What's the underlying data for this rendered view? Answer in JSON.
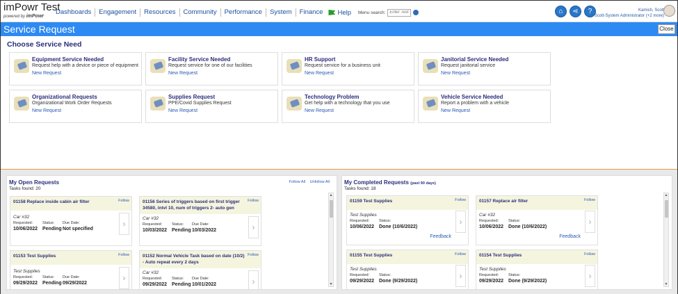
{
  "app": {
    "title": "imPowr Test",
    "powered_by": "powered by",
    "brand": "imPowr"
  },
  "nav": [
    "Dashboards",
    "Engagement",
    "Resources",
    "Community",
    "Performance",
    "System",
    "Finance"
  ],
  "help_label": "Help",
  "menu_search": {
    "label": "Menu search:",
    "placeholder": "Enter Text"
  },
  "user": {
    "name": "Kamish, Scott",
    "role": "Scott-System Administrator (+2 more)"
  },
  "icons": [
    "home-icon",
    "share-icon",
    "help-icon"
  ],
  "page_title": "Service Request",
  "close_label": "Close",
  "choose_title": "Choose Service Need",
  "services": [
    {
      "title": "Equipment Service Needed",
      "desc": "Request help with a device or piece of equipment",
      "link": "New Request"
    },
    {
      "title": "Facility Service Needed",
      "desc": "Request service for one of our facilities",
      "link": "New Request"
    },
    {
      "title": "HR Support",
      "desc": "Request service for a business unit",
      "link": "New Request"
    },
    {
      "title": "Janitorial Service Needed",
      "desc": "Request janitorial service",
      "link": "New Request"
    },
    {
      "title": "Organizational Requests",
      "desc": "Organizational Work Order Requests",
      "link": "New Request"
    },
    {
      "title": "Supplies Request",
      "desc": "PPE/Covid Supplies Request",
      "link": "New Request"
    },
    {
      "title": "Technology Problem",
      "desc": "Get help with a technology that you use",
      "link": "New Request"
    },
    {
      "title": "Vehicle Service Needed",
      "desc": "Report a problem with a vehicle",
      "link": "New Request"
    }
  ],
  "open": {
    "title": "My Open Requests",
    "count": "Tasks found: 20",
    "follow_all": "Follow All",
    "unfollow_all": "Unfollow All",
    "labels": {
      "requested": "Requested:",
      "status": "Status:",
      "due": "Due Date:"
    },
    "tasks": [
      {
        "title": "01158 Replace inside cabin air filter",
        "follow": "Follow",
        "sub": "Car #32",
        "requested": "10/06/2022",
        "status": "Pending",
        "due": "Not specified"
      },
      {
        "title": "01156 Series of triggers based on first trigger 34580, intvl 10, num of triggers 2- auto gen",
        "follow": "Follow",
        "sub": "Car #32",
        "requested": "10/03/2022",
        "status": "Pending",
        "due": "10/03/2022"
      },
      {
        "title": "01153 Test Supplies",
        "follow": "Follow",
        "sub": "Test Supplies",
        "requested": "09/29/2022",
        "status": "Pending",
        "due": "09/29/2022"
      },
      {
        "title": "01152 Normal Vehicle Task based on date (10/2) - Auto repeat every 2 days",
        "follow": "Follow",
        "sub": "Car #32",
        "requested": "09/29/2022",
        "status": "Pending",
        "due": "10/01/2022"
      }
    ]
  },
  "completed": {
    "title": "My Completed Requests",
    "title_suffix": "(past 90 days)",
    "count": "Tasks found: 18",
    "labels": {
      "requested": "Requested:",
      "status": "Status:"
    },
    "tasks": [
      {
        "title": "01159 Test Supplies",
        "follow": "Follow",
        "sub": "Test Supplies",
        "requested": "10/06/2022",
        "status": "Done (10/6/2022)",
        "feedback": "Feedback"
      },
      {
        "title": "01157 Replace air filter",
        "follow": "Follow",
        "sub": "Car #32",
        "requested": "10/06/2022",
        "status": "Done (10/6/2022)",
        "feedback": "Feedback"
      },
      {
        "title": "01155 Test Supplies",
        "follow": "Follow",
        "sub": "Test Supplies",
        "requested": "09/29/2022",
        "status": "Done (9/29/2022)"
      },
      {
        "title": "01154 Test Supplies",
        "follow": "Follow",
        "sub": "Test Supplies",
        "requested": "09/29/2022",
        "status": "Done (9/29/2022)"
      }
    ]
  },
  "colors": {
    "header_blue": "#2d8af3",
    "title_navy": "#2a2e7a",
    "link_blue": "#2a5ab5",
    "task_header": "#f5f5df"
  }
}
